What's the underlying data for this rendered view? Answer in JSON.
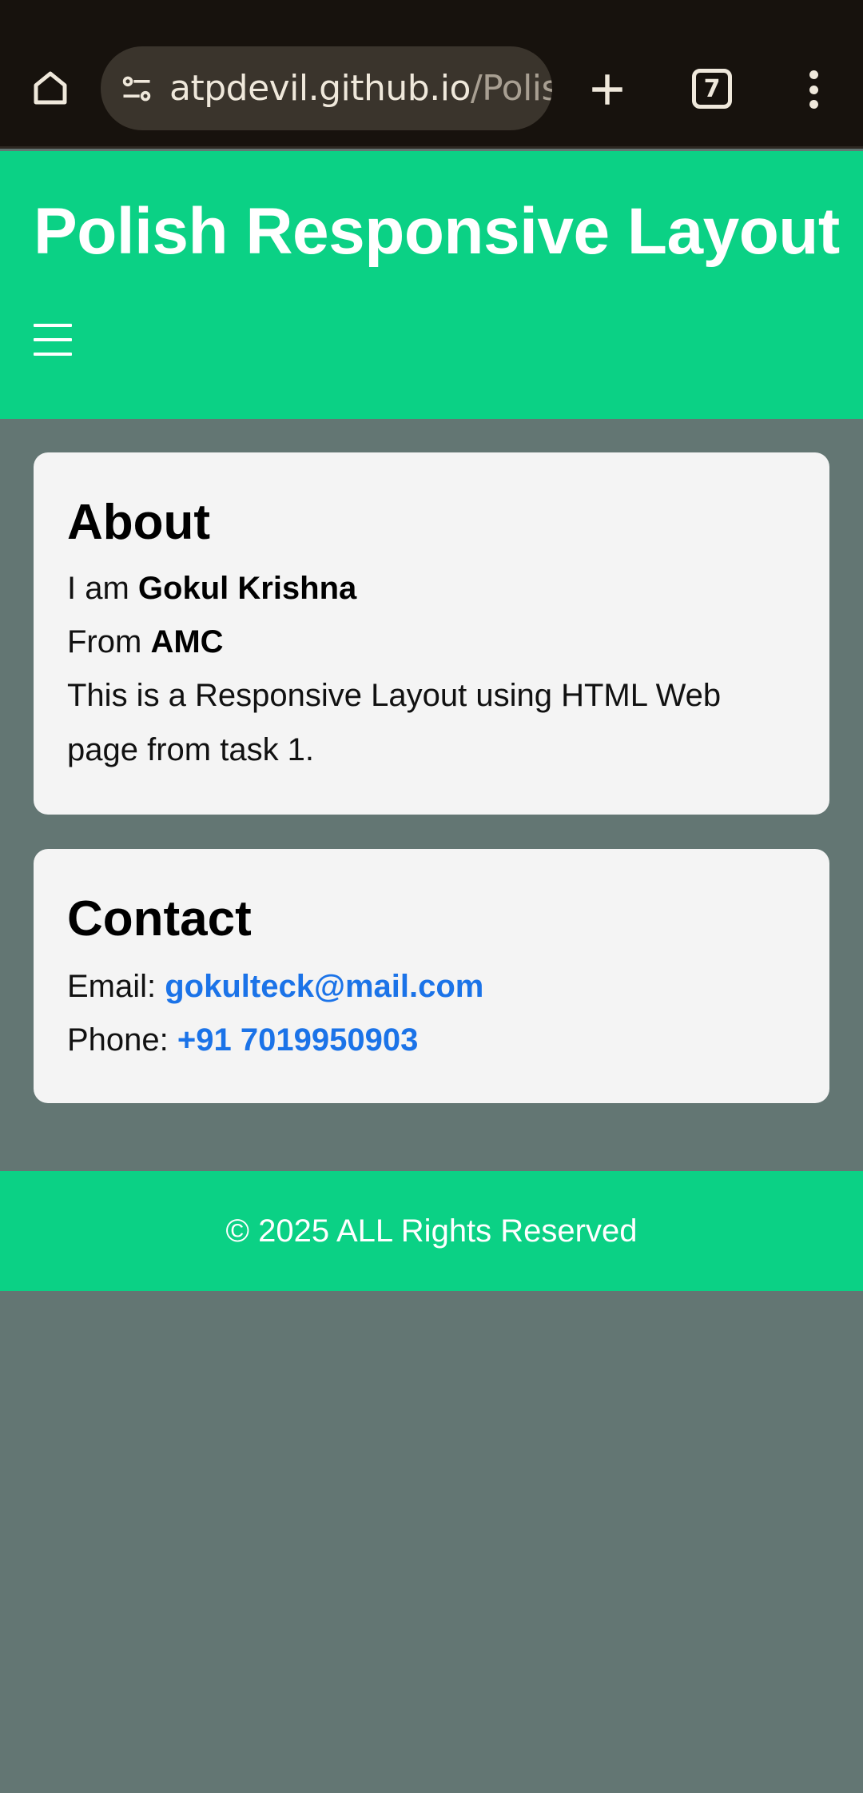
{
  "browser": {
    "url_host": "atpdevil.github.io",
    "url_path": "/Polish",
    "tab_count": "7",
    "icons": {
      "home": "home-icon",
      "site_settings": "tune-icon",
      "new_tab": "plus-icon",
      "tabs": "tab-switcher-icon",
      "menu": "more-vert-icon"
    }
  },
  "header": {
    "title": "Polish Responsive Layout",
    "menu_icon": "hamburger-icon"
  },
  "about": {
    "heading": "About",
    "line1_prefix": "I am ",
    "name": "Gokul Krishna",
    "line2_prefix": "From ",
    "org": "AMC",
    "description_line1": "This is a Responsive Layout using HTML Web",
    "description_line2": "page from task 1."
  },
  "contact": {
    "heading": "Contact",
    "email_label": "Email: ",
    "email": "gokulteck@mail.com",
    "phone_label": "Phone: ",
    "phone": "+91 7019950903"
  },
  "footer": {
    "text": "© 2025 ALL Rights Reserved"
  },
  "colors": {
    "header_bg": "#0bd185",
    "page_bg": "#637673",
    "card_bg": "#f4f4f4",
    "link": "#1b73e8",
    "browser_bar": "#17120d"
  }
}
